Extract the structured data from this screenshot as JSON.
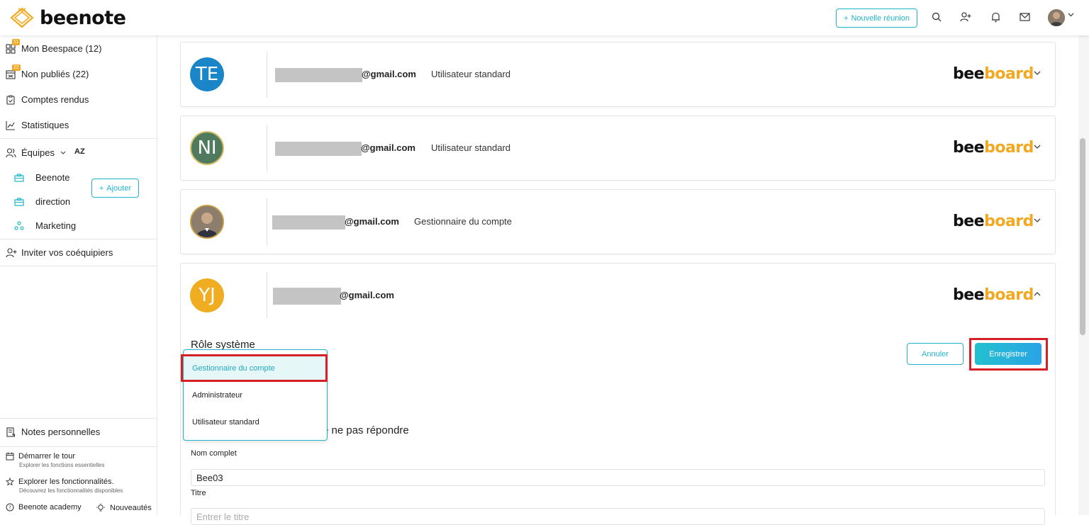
{
  "header": {
    "logo_text": "beenote",
    "new_meeting_label": "Nouvelle réunion"
  },
  "sidebar": {
    "items": [
      {
        "label": "Mon Beespace (12)",
        "badge": "11"
      },
      {
        "label": "Non publiés (22)",
        "badge": "22"
      },
      {
        "label": "Comptes rendus"
      },
      {
        "label": "Statistiques"
      }
    ],
    "teams_label": "Équipes",
    "sort_label": "AZ",
    "add_label": "Ajouter",
    "teams": [
      "Beenote",
      "direction",
      "Marketing"
    ],
    "invite_label": "Inviter vos coéquipiers",
    "notes_label": "Notes personnelles",
    "tour_label": "Démarrer le tour",
    "tour_sub": "Explorer les fonctions essentielles",
    "explore_label": "Explorer les fonctionnalités.",
    "explore_sub": "Découvrez les fonctionnalités disponibles",
    "academy_label": "Beenote academy",
    "news_label": "Nouveautés"
  },
  "users": [
    {
      "initials": "TE",
      "email": "@gmail.com",
      "role": "Utilisateur standard",
      "color": "#1a86c8"
    },
    {
      "initials": "NI",
      "email": "@gmail.com",
      "role": "Utilisateur standard",
      "color": "#4f7a5e"
    },
    {
      "initials": "",
      "email": "@gmail.com",
      "role": "Gestionnaire du compte",
      "color": "#5a4a3c"
    },
    {
      "initials": "YJ",
      "email": "@gmail.com",
      "role": "",
      "color": "#f0ad22"
    }
  ],
  "brand": {
    "part1": "bee",
    "part2": "board"
  },
  "edit": {
    "system_role_title": "Rôle système",
    "cancel_label": "Annuler",
    "save_label": "Enregistrer",
    "hidden_title_suffix": "e ne pas répondre",
    "dropdown_options": [
      "Gestionnaire du compte",
      "Administrateur",
      "Utilisateur standard"
    ],
    "selected_option": "Gestionnaire du compte",
    "full_name_label": "Nom complet",
    "full_name_value": "Bee03",
    "title_label": "Titre",
    "title_placeholder": "Entrer le titre"
  },
  "colors": {
    "accent": "#22b5c9",
    "brand_yellow": "#f2a922",
    "highlight": "#d61f26"
  }
}
